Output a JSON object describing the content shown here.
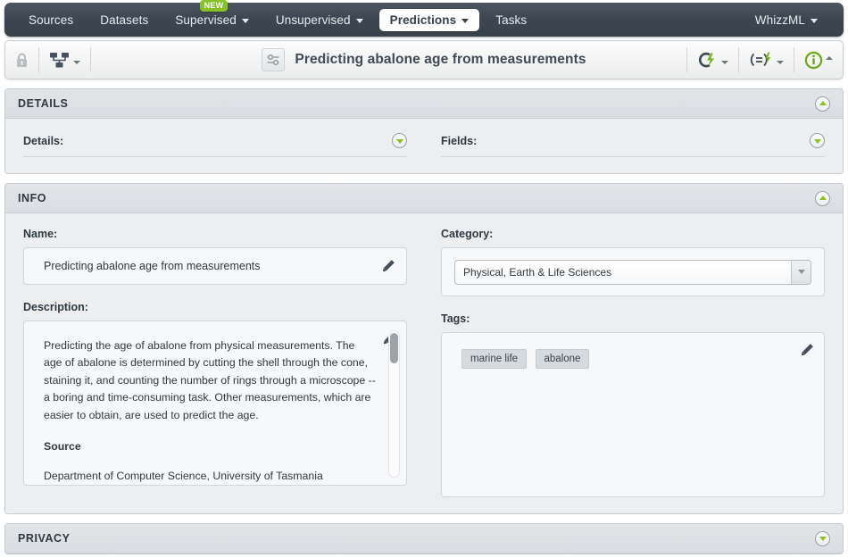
{
  "nav": {
    "items": [
      {
        "label": "Sources",
        "caret": false,
        "active": false,
        "badge": null
      },
      {
        "label": "Datasets",
        "caret": false,
        "active": false,
        "badge": null
      },
      {
        "label": "Supervised",
        "caret": true,
        "active": false,
        "badge": "NEW"
      },
      {
        "label": "Unsupervised",
        "caret": true,
        "active": false,
        "badge": null
      },
      {
        "label": "Predictions",
        "caret": true,
        "active": true,
        "badge": null
      },
      {
        "label": "Tasks",
        "caret": false,
        "active": false,
        "badge": null
      }
    ],
    "account": {
      "label": "WhizzML",
      "caret": true
    }
  },
  "toolbar": {
    "lock_icon": "lock-icon",
    "tree_icon": "hierarchy-tree-icon",
    "title_icon": "sliders-icon",
    "title": "Predicting abalone age from measurements",
    "actions": [
      {
        "icon": "cloud-lightning-icon",
        "name": "configure-action-button"
      },
      {
        "icon": "list-lightning-icon",
        "name": "batch-action-button"
      },
      {
        "icon": "info-circle-icon",
        "name": "info-button"
      }
    ]
  },
  "details_section": {
    "title": "DETAILS",
    "expanded": true,
    "rows": [
      {
        "label": "Details:"
      },
      {
        "label": "Fields:"
      }
    ]
  },
  "info_section": {
    "title": "INFO",
    "expanded": true,
    "name": {
      "label": "Name:",
      "value": "Predicting abalone age from measurements"
    },
    "category": {
      "label": "Category:",
      "value": "Physical, Earth & Life Sciences"
    },
    "description": {
      "label": "Description:",
      "paragraph": "Predicting the age of abalone from physical measurements. The age of abalone is determined by cutting the shell through the cone, staining it, and counting the number of rings through a microscope -- a boring and time-consuming task. Other measurements, which are easier to obtain, are used to predict the age.",
      "source_heading": "Source",
      "source_text": "Department of Computer Science, University of Tasmania"
    },
    "tags": {
      "label": "Tags:",
      "items": [
        "marine life",
        "abalone"
      ]
    }
  },
  "privacy_section": {
    "title": "PRIVACY",
    "expanded": false
  },
  "colors": {
    "nav_background": "#3d4650",
    "accent_green": "#85c226",
    "panel_header": "#dde1e5",
    "panel_body": "#eceef0",
    "text_dark": "#2f3940"
  }
}
